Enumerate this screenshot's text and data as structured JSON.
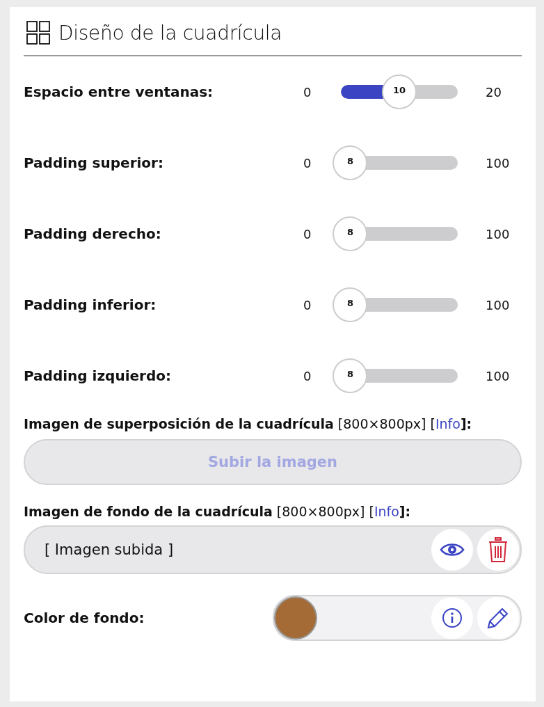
{
  "panel": {
    "title": "Diseño de la cuadrícula"
  },
  "sliders": [
    {
      "label": "Espacio entre ventanas:",
      "min": "0",
      "max": "20",
      "value": "10",
      "level": 0.5
    },
    {
      "label": "Padding superior:",
      "min": "0",
      "max": "100",
      "value": "8",
      "level": 0.08
    },
    {
      "label": "Padding derecho:",
      "min": "0",
      "max": "100",
      "value": "8",
      "level": 0.08
    },
    {
      "label": "Padding inferior:",
      "min": "0",
      "max": "100",
      "value": "8",
      "level": 0.08
    },
    {
      "label": "Padding izquierdo:",
      "min": "0",
      "max": "100",
      "value": "8",
      "level": 0.08
    }
  ],
  "overlay_image": {
    "label": "Imagen de superposición de la cuadrícula",
    "size_note": "[800×800px]",
    "link_open": "[",
    "info_link": "Info",
    "link_close": "]:",
    "upload_button": {
      "label": "Subir la imagen",
      "disabled": true
    }
  },
  "background_image": {
    "label": "Imagen de fondo de la cuadrícula",
    "size_note": "[800×800px]",
    "link_open": "[",
    "info_link": "Info",
    "link_close": "]:",
    "value": "[ Imagen subida ]"
  },
  "background_color": {
    "label": "Color de fondo:",
    "color": "#a56b37"
  }
}
